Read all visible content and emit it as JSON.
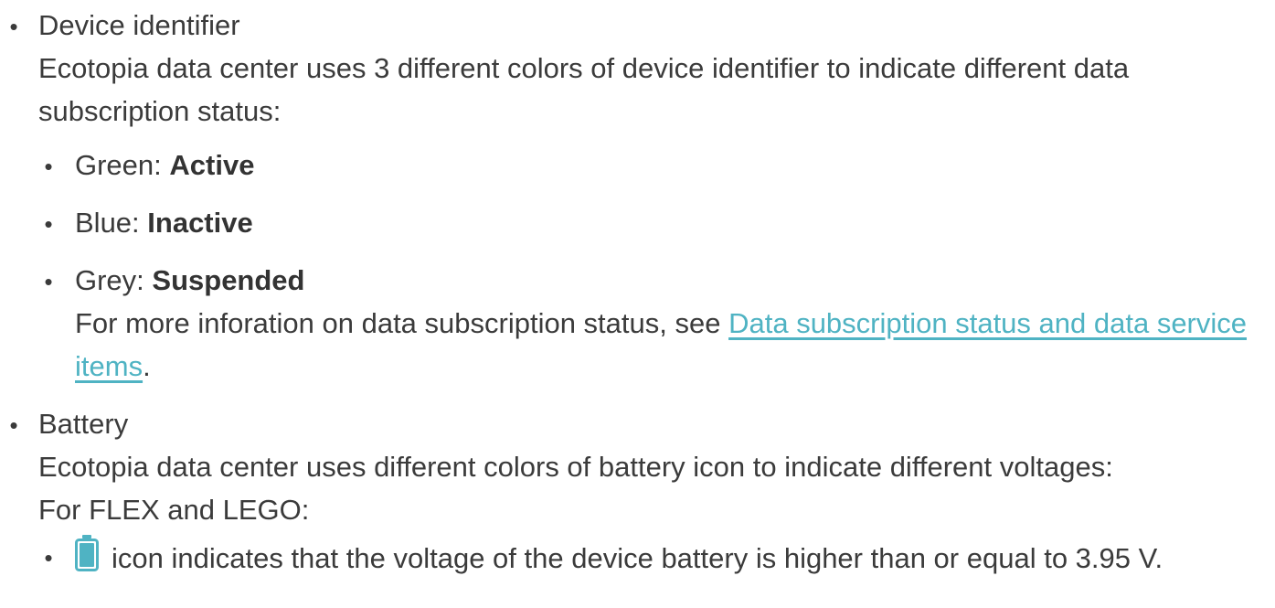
{
  "device_identifier": {
    "heading": "Device identifier",
    "description": "Ecotopia data center uses 3 different colors of device identifier to indicate different data subscription status:",
    "statuses": [
      {
        "color_label": "Green: ",
        "status": "Active",
        "color": "#3fa34d"
      },
      {
        "color_label": "Blue: ",
        "status": "Inactive",
        "color": "#3b7dd8"
      },
      {
        "color_label": "Grey: ",
        "status": "Suspended",
        "color": "#9a9a9a"
      }
    ],
    "more_info_prefix": "For more inforation on data subscription status, see ",
    "more_info_link": "Data subscription status and data service items",
    "more_info_suffix": "."
  },
  "battery": {
    "heading": "Battery",
    "description": "Ecotopia data center uses different colors of battery icon to indicate different voltages:",
    "models_line": "For FLEX and LEGO:",
    "levels": [
      {
        "icon": "battery-full-icon",
        "icon_color": "#4fb3c3",
        "text": "icon indicates that the voltage of the device battery is higher than or equal to 3.95 V."
      }
    ]
  },
  "colors": {
    "text": "#3b3b3b",
    "link": "#4fb3c3"
  }
}
